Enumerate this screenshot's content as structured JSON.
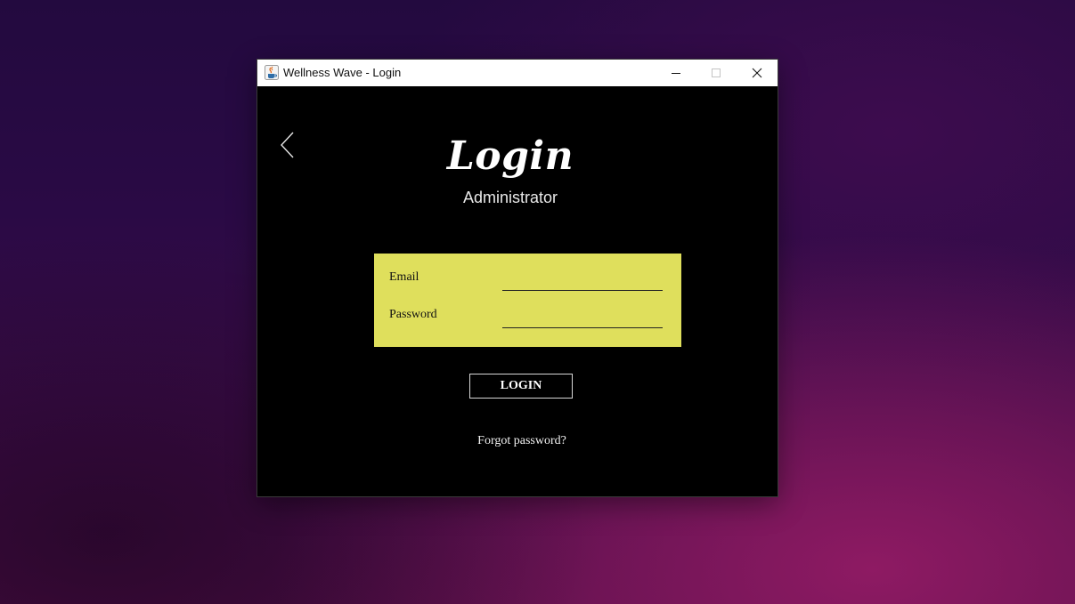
{
  "window": {
    "title": "Wellness Wave - Login",
    "icon": "java-cup-icon",
    "controls": {
      "minimize": "minimize-icon",
      "maximize": "maximize-icon",
      "close": "close-icon"
    }
  },
  "page": {
    "heading": "Login",
    "subheading": "Administrator",
    "back_icon": "chevron-left-icon"
  },
  "form": {
    "email_label": "Email",
    "email_value": "",
    "password_label": "Password",
    "password_value": "",
    "panel_color": "#dfdf5c"
  },
  "actions": {
    "login_label": "LOGIN",
    "forgot_label": "Forgot password?"
  },
  "colors": {
    "window_background": "#000000",
    "form_panel": "#dfdf5c",
    "text_light": "#ffffff"
  }
}
